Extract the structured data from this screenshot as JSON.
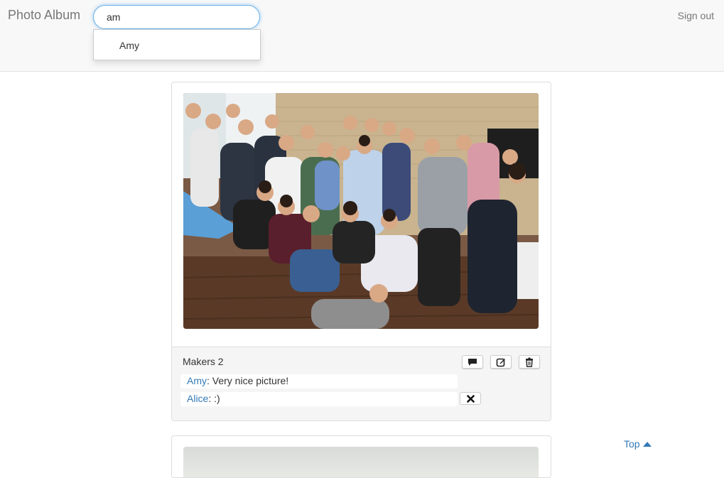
{
  "navbar": {
    "brand": "Photo Album",
    "search": {
      "value": "am"
    },
    "suggestions": [
      "Amy"
    ],
    "signout_label": "Sign out"
  },
  "posts": [
    {
      "caption": "Makers 2",
      "comments": [
        {
          "author": "Amy",
          "text": "Very nice picture!"
        },
        {
          "author": "Alice",
          "text": ":)"
        }
      ],
      "actions": [
        "comment-icon",
        "edit-icon",
        "trash-icon"
      ],
      "comment_delete_icon": "close-icon"
    }
  ],
  "top_link": {
    "label": "Top",
    "icon": "triangle-up-icon"
  },
  "colors": {
    "link": "#337ab7",
    "navbar_bg": "#f8f8f8",
    "focus": "#66afe9"
  }
}
